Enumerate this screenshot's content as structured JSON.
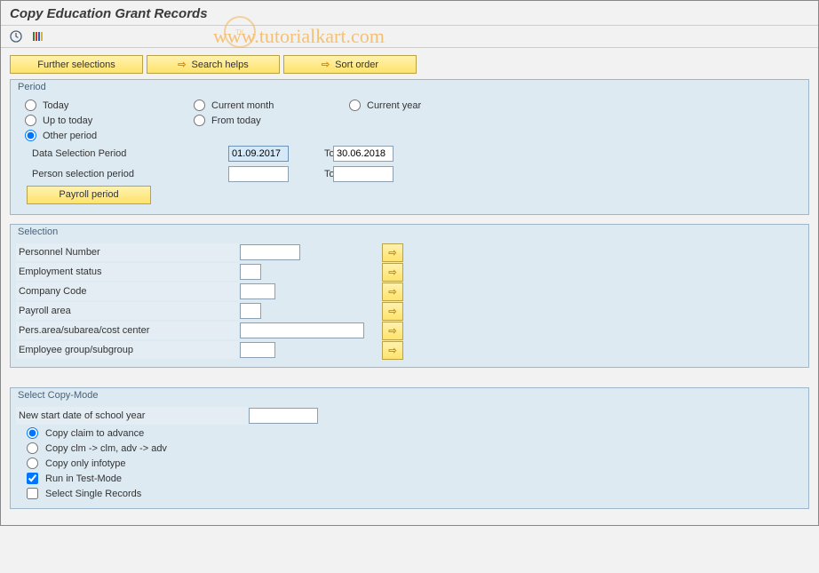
{
  "title": "Copy Education Grant Records",
  "watermark": "www.tutorialkart.com",
  "toolbarButtons": {
    "further": "Further selections",
    "searchHelps": "Search helps",
    "sortOrder": "Sort order"
  },
  "period": {
    "groupTitle": "Period",
    "today": "Today",
    "currentMonth": "Current month",
    "currentYear": "Current year",
    "upToToday": "Up to today",
    "fromToday": "From today",
    "otherPeriod": "Other period",
    "dataSelectionLabel": "Data Selection Period",
    "dataSelectionFrom": "01.09.2017",
    "dataSelectionTo": "30.06.2018",
    "toLabel": "To",
    "personSelectionLabel": "Person selection period",
    "personSelectionFrom": "",
    "personSelectionTo": "",
    "payrollPeriodBtn": "Payroll period"
  },
  "selection": {
    "groupTitle": "Selection",
    "personnelNumber": "Personnel Number",
    "employmentStatus": "Employment status",
    "companyCode": "Company Code",
    "payrollArea": "Payroll area",
    "persArea": "Pers.area/subarea/cost center",
    "employeeGroup": "Employee group/subgroup"
  },
  "copyMode": {
    "groupTitle": "Select Copy-Mode",
    "newStartDateLabel": "New start date of school year",
    "newStartDateValue": "",
    "copyClaimAdvance": "Copy claim to advance",
    "copyClmAdv": "Copy clm -> clm, adv -> adv",
    "copyOnlyInfotype": "Copy only infotype",
    "runTestMode": "Run in Test-Mode",
    "selectSingle": "Select Single Records"
  }
}
